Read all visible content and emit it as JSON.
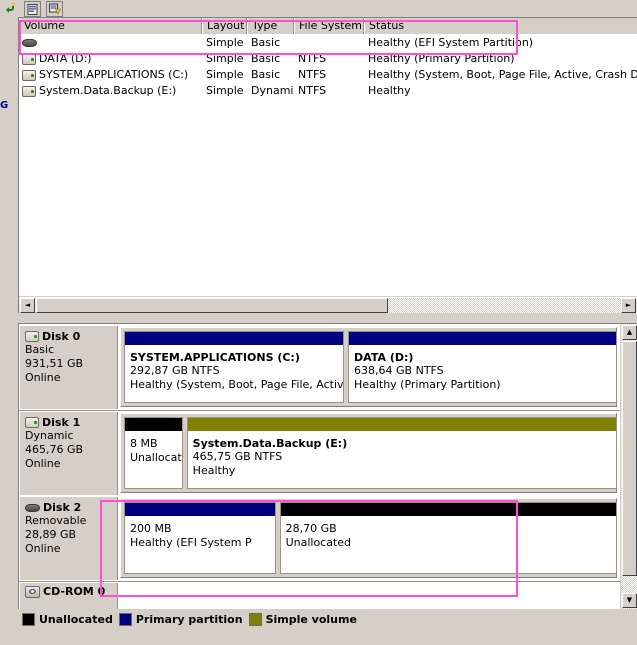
{
  "toolbar": {
    "buttons": [
      {
        "name": "back-navigate-icon",
        "glyph": "↵"
      },
      {
        "name": "properties-icon",
        "glyph": "▤"
      },
      {
        "name": "rescan-disks-icon",
        "glyph": "▤"
      }
    ]
  },
  "gutter": {
    "fragment": "G"
  },
  "volume_list": {
    "columns": [
      {
        "key": "volume",
        "label": "Volume"
      },
      {
        "key": "layout",
        "label": "Layout"
      },
      {
        "key": "type",
        "label": "Type"
      },
      {
        "key": "filesystem",
        "label": "File System"
      },
      {
        "key": "status",
        "label": "Status"
      }
    ],
    "rows": [
      {
        "icon": "removable-drive-icon",
        "volume": "",
        "layout": "Simple",
        "type": "Basic",
        "filesystem": "",
        "status": "Healthy (EFI System Partition)"
      },
      {
        "icon": "hard-drive-icon",
        "volume": "DATA (D:)",
        "layout": "Simple",
        "type": "Basic",
        "filesystem": "NTFS",
        "status": "Healthy (Primary Partition)"
      },
      {
        "icon": "hard-drive-icon",
        "volume": "SYSTEM.APPLICATIONS (C:)",
        "layout": "Simple",
        "type": "Basic",
        "filesystem": "NTFS",
        "status": "Healthy (System, Boot, Page File, Active, Crash Dump, P"
      },
      {
        "icon": "hard-drive-icon",
        "volume": "System.Data.Backup (E:)",
        "layout": "Simple",
        "type": "Dynamic",
        "filesystem": "NTFS",
        "status": "Healthy"
      }
    ]
  },
  "disks": [
    {
      "name": "Disk 0",
      "icon": "hard-drive-icon",
      "type": "Basic",
      "capacity": "931,51 GB",
      "state": "Online",
      "partitions": [
        {
          "title": "SYSTEM.APPLICATIONS  (C:)",
          "size": "292,87 GB NTFS",
          "status": "Healthy (System, Boot, Page File, Active, Cra",
          "bar_color": "#000080",
          "width_pct": 45
        },
        {
          "title": "DATA  (D:)",
          "size": "638,64 GB NTFS",
          "status": "Healthy (Primary Partition)",
          "bar_color": "#000080",
          "width_pct": 55
        }
      ]
    },
    {
      "name": "Disk 1",
      "icon": "hard-drive-icon",
      "type": "Dynamic",
      "capacity": "465,76 GB",
      "state": "Online",
      "partitions": [
        {
          "title": "",
          "size": "8 MB",
          "status": "Unallocate",
          "bar_color": "#000000",
          "width_pct": 12
        },
        {
          "title": "System.Data.Backup  (E:)",
          "size": "465,75 GB NTFS",
          "status": "Healthy",
          "bar_color": "#808000",
          "width_pct": 88
        }
      ]
    },
    {
      "name": "Disk 2",
      "icon": "removable-drive-icon",
      "type": "Removable",
      "capacity": "28,89 GB",
      "state": "Online",
      "partitions": [
        {
          "title": "",
          "size": "200 MB",
          "status": "Healthy (EFI System P",
          "bar_color": "#000080",
          "width_pct": 31
        },
        {
          "title": "",
          "size": "28,70 GB",
          "status": "Unallocated",
          "bar_color": "#000000",
          "width_pct": 69
        }
      ]
    }
  ],
  "cdrom": {
    "name": "CD-ROM 0",
    "icon": "cd-drive-icon"
  },
  "legend": [
    {
      "label": "Unallocated",
      "color": "#000000"
    },
    {
      "label": "Primary partition",
      "color": "#000080"
    },
    {
      "label": "Simple volume",
      "color": "#808000"
    }
  ],
  "scrollbars": {
    "volume_h_left_arrow": "◄",
    "volume_h_right_arrow": "►",
    "disk_v_up_arrow": "▲",
    "disk_v_down_arrow": "▼"
  },
  "annotation": {
    "color": "#ff4fd8"
  }
}
